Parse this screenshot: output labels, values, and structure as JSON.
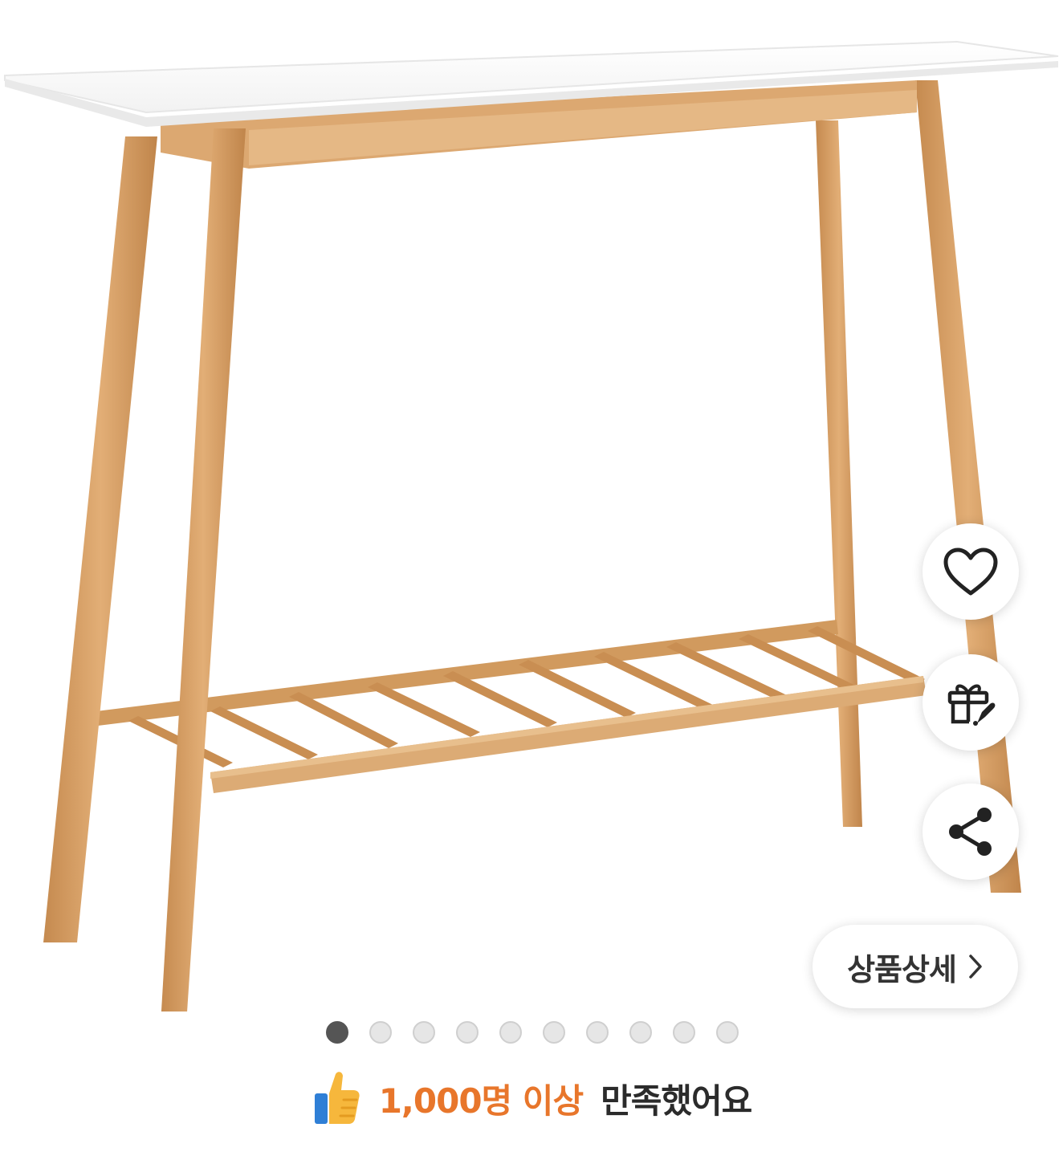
{
  "product": {
    "image_alt": "console table with white top, wooden legs and slatted bottom shelf"
  },
  "actions": {
    "like_icon": "heart-icon",
    "gift_icon": "gift-icon",
    "share_icon": "share-icon"
  },
  "detail_button": {
    "label": "상품상세",
    "icon": "chevron-right-icon"
  },
  "carousel": {
    "total": 10,
    "active_index": 0
  },
  "satisfaction": {
    "icon": "thumbs-up-icon",
    "highlight": "1,000명 이상",
    "text": "만족했어요"
  },
  "colors": {
    "accent": "#e8762b",
    "wood": "#d9a064",
    "table_top": "#ffffff"
  }
}
